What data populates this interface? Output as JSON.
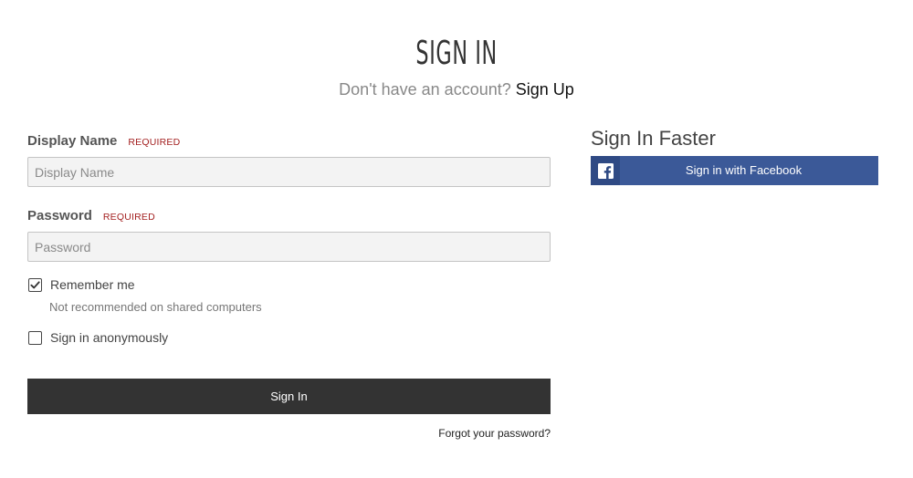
{
  "header": {
    "title": "SIGN IN",
    "prompt": "Don't have an account?",
    "signup_link": "Sign Up"
  },
  "form": {
    "display_name": {
      "label": "Display Name",
      "required": "REQUIRED",
      "placeholder": "Display Name",
      "value": ""
    },
    "password": {
      "label": "Password",
      "required": "REQUIRED",
      "placeholder": "Password",
      "value": ""
    },
    "remember_me": {
      "label": "Remember me",
      "hint": "Not recommended on shared computers",
      "checked": true
    },
    "anonymous": {
      "label": "Sign in anonymously",
      "checked": false
    },
    "submit_label": "Sign In",
    "forgot_label": "Forgot your password?"
  },
  "sign_in_faster": {
    "title": "Sign In Faster",
    "facebook_label": "Sign in with Facebook",
    "facebook_icon": "facebook-icon",
    "facebook_color": "#3b5998"
  }
}
